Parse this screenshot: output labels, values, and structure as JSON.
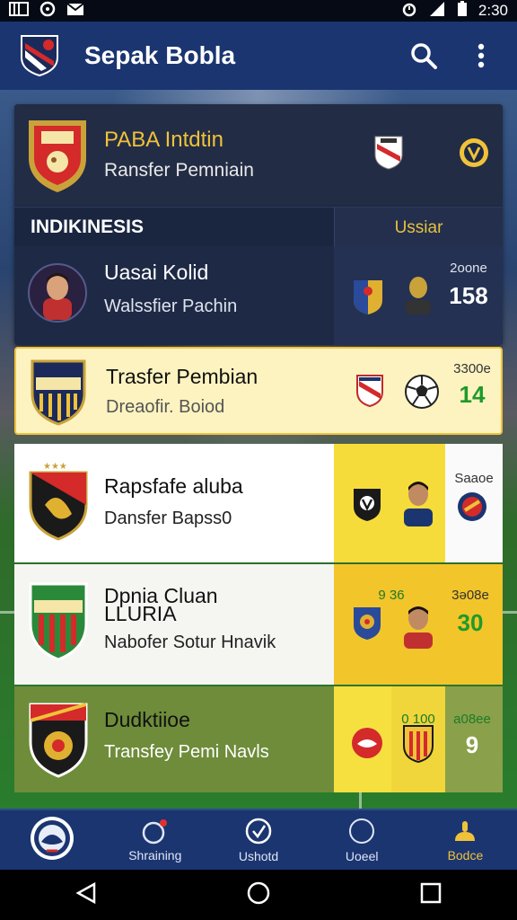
{
  "status": {
    "time": "2:30"
  },
  "app": {
    "title": "Sepak Bobla"
  },
  "league": {
    "name": "PABA Intdtin",
    "subtitle": "Ransfer Pemniain"
  },
  "section": {
    "label": "INDIKINESIS",
    "right_label": "Ussiar"
  },
  "rows": [
    {
      "name": "Uasai Kolid",
      "subtitle": "Walssfier Pachin",
      "score_top": "2oone",
      "score": "158"
    },
    {
      "name": "Trasfer Pembian",
      "subtitle": "Dreaofir. Boiod",
      "score_top": "3300e",
      "score": "14"
    },
    {
      "name": "Rapsfafe aluba",
      "subtitle": "Dansfer Bapss0",
      "score_top": "Saaoe",
      "score": ""
    },
    {
      "name": "Dpnia Cluan",
      "name2": "LLURIA",
      "subtitle": "Nabofer Sotur Hnavik",
      "score_mid_top": "9 36",
      "score_top": "3ə08e",
      "score": "30"
    },
    {
      "name": "Dudktiioe",
      "subtitle": "Transfey Pemi Navls",
      "score_mid_top": "0 100",
      "score_top": "a08ee",
      "score": "9"
    }
  ],
  "nav": [
    {
      "label": "",
      "icon": "club-logo-icon"
    },
    {
      "label": "Shraining",
      "icon": "whistle-icon"
    },
    {
      "label": "Ushotd",
      "icon": "check-circle-icon"
    },
    {
      "label": "Uoeel",
      "icon": "circle-icon"
    },
    {
      "label": "Bodce",
      "icon": "trophy-icon"
    }
  ],
  "colors": {
    "appbar": "#1b3571",
    "accent": "#f0c23a",
    "highlight": "#fdf3c0",
    "green_score": "#1e9a2a"
  }
}
